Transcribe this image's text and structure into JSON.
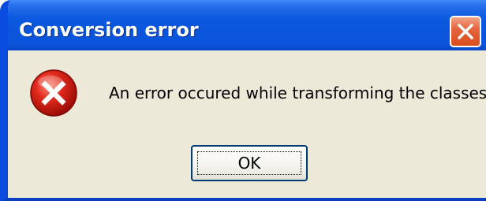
{
  "dialog": {
    "title": "Conversion error",
    "message": "An error occured while transforming the classes.",
    "ok_label": "OK",
    "icon": "error-icon"
  },
  "colors": {
    "titlebar": "#0b55dd",
    "body": "#ece9d8",
    "close_button": "#e5663e",
    "error_icon": "#d42020"
  }
}
